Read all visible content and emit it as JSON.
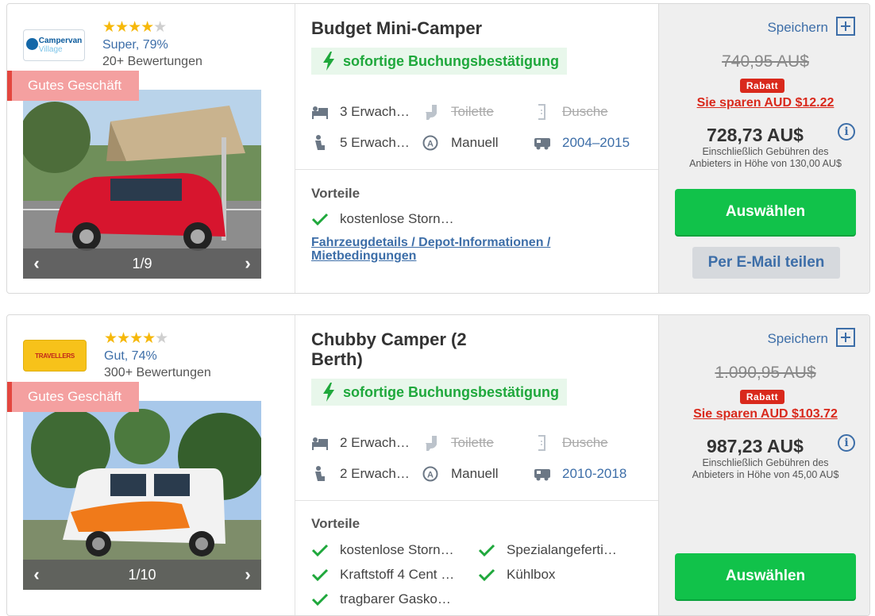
{
  "listings": [
    {
      "logo_text": "Campervan",
      "logo_sub": "Village",
      "stars_on": "★★★★",
      "stars_off": "★",
      "rating": "Super, 79%",
      "reviews": "20+ Bewertungen",
      "badge": "Gutes Geschäft",
      "photo_count": "1/9",
      "title_line1": "Budget Mini-Camper",
      "title_line2": "",
      "instant": "sofortige Buchungsbestätigung",
      "specs": {
        "adults": "3 Erwach…",
        "seats": "5 Erwach…",
        "toilet": "Toilette",
        "transmission": "Manuell",
        "shower": "Dusche",
        "years": "2004–2015"
      },
      "vorteile_label": "Vorteile",
      "vorteile": [
        "kostenlose Storn…"
      ],
      "details_link": "Fahrzeugdetails / Depot-Informationen / Mietbedingungen",
      "save_label": "Speichern",
      "old_price": "740,95 AU$",
      "rabatt": "Rabatt",
      "saving": "Sie sparen AUD $12.22",
      "price": "728,73 AU$",
      "fees": "Einschließlich Gebühren des Anbieters in Höhe von 130,00 AU$",
      "select_label": "Auswählen",
      "mail_label": "Per E-Mail teilen"
    },
    {
      "logo_text": "TRAVELLERS",
      "stars_on": "★★★★",
      "stars_off": "★",
      "rating": "Gut, 74%",
      "reviews": "300+ Bewertungen",
      "badge": "Gutes Geschäft",
      "photo_count": "1/10",
      "title_line1": "Chubby Camper (2",
      "title_line2": "Berth)",
      "instant": "sofortige Buchungsbestätigung",
      "specs": {
        "adults": "2 Erwach…",
        "seats": "2 Erwach…",
        "toilet": "Toilette",
        "transmission": "Manuell",
        "shower": "Dusche",
        "years": "2010-2018"
      },
      "vorteile_label": "Vorteile",
      "vorteile": [
        "kostenlose Storn…",
        "Spezialangeferti…",
        "Kraftstoff 4 Cent …",
        "Kühlbox",
        "tragbarer Gasko…"
      ],
      "save_label": "Speichern",
      "old_price": "1.090,95 AU$",
      "rabatt": "Rabatt",
      "saving": "Sie sparen AUD $103.72",
      "price": "987,23 AU$",
      "fees": "Einschließlich Gebühren des Anbieters in Höhe von 45,00 AU$",
      "select_label": "Auswählen"
    }
  ],
  "icons": {
    "prev": "‹",
    "next": "›",
    "info": "i"
  },
  "colors": {
    "accent_blue": "#3d6ea8",
    "green": "#11c24a",
    "red": "#d9291c",
    "badge_pink": "#f4a0a0"
  }
}
